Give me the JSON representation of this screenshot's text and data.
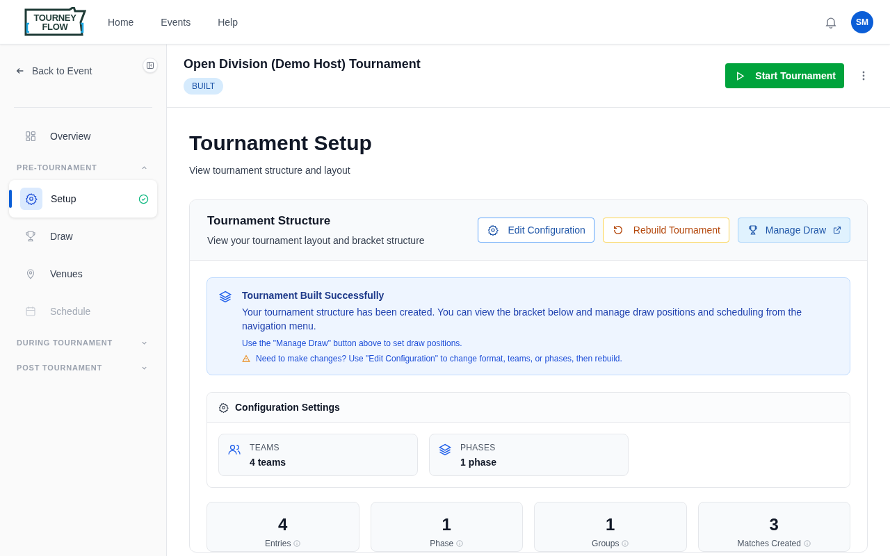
{
  "topbar": {
    "logo": [
      "TOURNEY",
      "FLOW"
    ],
    "nav": [
      {
        "label": "Home",
        "selected": false
      },
      {
        "label": "Events",
        "selected": false
      },
      {
        "label": "Help",
        "selected": false
      }
    ],
    "avatar": "SM"
  },
  "sidebar": {
    "back": "Back to Event",
    "top_items": [
      {
        "label": "Overview",
        "selected": false
      }
    ],
    "sections": [
      {
        "title": "PRE-TOURNAMENT",
        "expanded": true,
        "items": [
          {
            "label": "Setup",
            "selected": true,
            "completed": true,
            "disabled": false
          },
          {
            "label": "Draw",
            "selected": false,
            "completed": false,
            "disabled": false
          },
          {
            "label": "Venues",
            "selected": false,
            "completed": false,
            "disabled": false
          },
          {
            "label": "Schedule",
            "selected": false,
            "completed": false,
            "disabled": true
          }
        ]
      },
      {
        "title": "DURING TOURNAMENT",
        "expanded": false
      },
      {
        "title": "POST TOURNAMENT",
        "expanded": false
      }
    ]
  },
  "header": {
    "title": "Open Division (Demo Host) Tournament",
    "status": "BUILT",
    "primary_action": "Start Tournament"
  },
  "page": {
    "title": "Tournament Setup",
    "subtitle": "View tournament structure and layout"
  },
  "structure": {
    "title": "Tournament Structure",
    "subtitle": "View your tournament layout and bracket structure",
    "actions": [
      {
        "label": "Edit Configuration",
        "kind": "edit"
      },
      {
        "label": "Rebuild Tournament",
        "kind": "rebuild"
      },
      {
        "label": "Manage Draw",
        "kind": "draw"
      }
    ],
    "alert": {
      "title": "Tournament Built Successfully",
      "body": "Your tournament structure has been created. You can view the bracket below and manage draw positions and scheduling from the navigation menu.",
      "hint": "Use the \"Manage Draw\" button above to set draw positions.",
      "warning": "Need to make changes? Use \"Edit Configuration\" to change format, teams, or phases, then rebuild."
    },
    "config": {
      "title": "Configuration Settings",
      "items": [
        {
          "label": "TEAMS",
          "value": "4 teams",
          "kind": "teams"
        },
        {
          "label": "PHASES",
          "value": "1 phase",
          "kind": "phases"
        }
      ]
    },
    "stats": [
      {
        "value": "4",
        "label": "Entries"
      },
      {
        "value": "1",
        "label": "Phase"
      },
      {
        "value": "1",
        "label": "Groups"
      },
      {
        "value": "3",
        "label": "Matches Created"
      }
    ]
  }
}
